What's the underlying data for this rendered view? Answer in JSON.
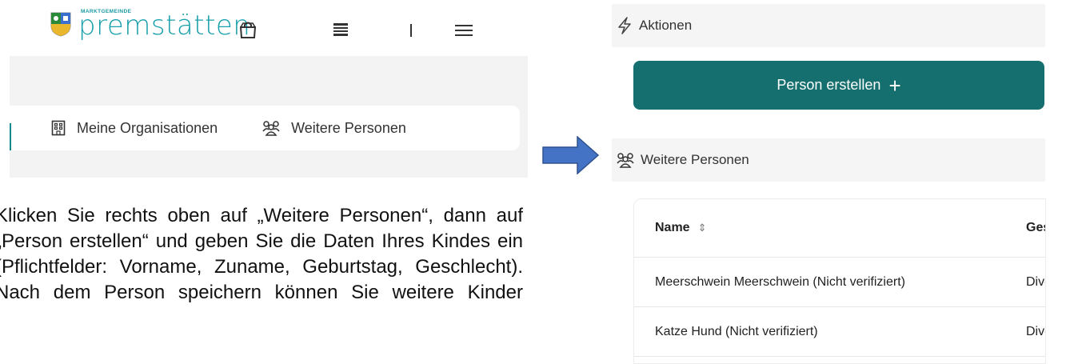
{
  "header": {
    "brand_small": "MARKTGEMEINDE",
    "brand_name": "premstätten",
    "icons": [
      "bag-icon",
      "server-icon",
      "divider-icon",
      "menu-icon"
    ]
  },
  "tabs": [
    {
      "label": "Meine Organisationen",
      "icon": "building-icon"
    },
    {
      "label": "Weitere Personen",
      "icon": "people-icon"
    }
  ],
  "instruction": "Klicken Sie rechts oben auf „Weitere Personen“, dann auf „Person erstellen“ und geben Sie die Daten Ihres Kindes ein (Pflichtfelder: Vorname, Zuname, Geburtstag, Geschlecht). Nach dem Person speichern können Sie weitere Kinder",
  "actions": {
    "title": "Aktionen",
    "icon": "lightning-icon",
    "create_button": "Person erstellen",
    "create_icon": "+"
  },
  "persons": {
    "title": "Weitere Personen",
    "icon": "people-icon",
    "columns": [
      "Name",
      "Ges"
    ],
    "sort_icon": "⇕",
    "rows": [
      {
        "name": "Meerschwein Meerschwein (Nicht verifiziert)",
        "gender": "Dive"
      },
      {
        "name": "Katze Hund (Nicht verifiziert)",
        "gender": "Dive"
      }
    ]
  },
  "colors": {
    "brand": "#1aa0ac",
    "primary_button": "#166f6f",
    "arrow": "#4472c4",
    "panel_bg": "#f3f3f3"
  }
}
